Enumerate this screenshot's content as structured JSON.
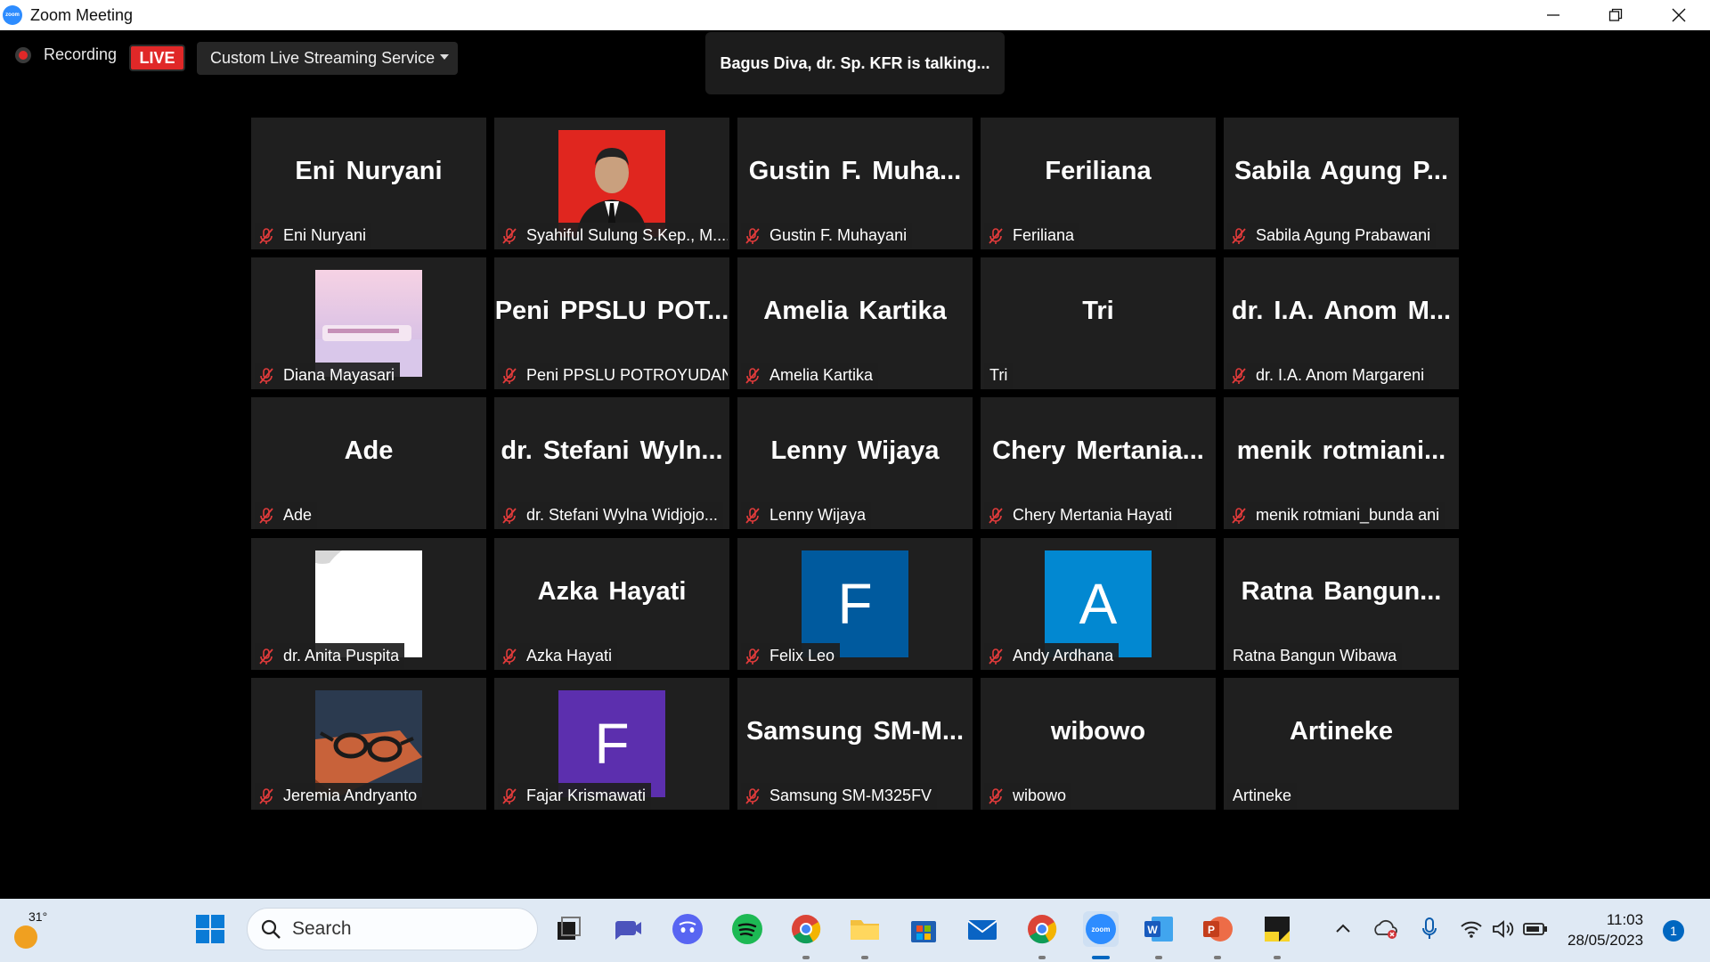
{
  "window": {
    "title": "Zoom Meeting",
    "app_icon_label": "zoom"
  },
  "toolbar": {
    "recording_label": "Recording",
    "live_label": "LIVE",
    "stream_service": "Custom Live Streaming Service"
  },
  "talking_banner": "Bagus Diva, dr. Sp. KFR is talking...",
  "participants": [
    {
      "display": "Eni Nuryani",
      "name": "Eni Nuryani",
      "muted": true
    },
    {
      "display": "",
      "name": "Syahiful Sulung S.Kep., M....",
      "muted": true,
      "photo": "portrait-red-background"
    },
    {
      "display": "Gustin F. Muha...",
      "name": "Gustin F. Muhayani",
      "muted": true
    },
    {
      "display": "Feriliana",
      "name": "Feriliana",
      "muted": true
    },
    {
      "display": "Sabila Agung P...",
      "name": "Sabila Agung Prabawani",
      "muted": true
    },
    {
      "display": "",
      "name": "Diana Mayasari",
      "muted": true,
      "photo": "pink-train-scene"
    },
    {
      "display": "Peni PPSLU POT...",
      "name": "Peni PPSLU POTROYUDAN",
      "muted": true
    },
    {
      "display": "Amelia Kartika",
      "name": "Amelia Kartika",
      "muted": true
    },
    {
      "display": "Tri",
      "name": "Tri",
      "muted": false
    },
    {
      "display": "dr. I.A. Anom M...",
      "name": "dr. I.A. Anom Margareni",
      "muted": true
    },
    {
      "display": "Ade",
      "name": "Ade",
      "muted": true
    },
    {
      "display": "dr. Stefani Wyln...",
      "name": "dr. Stefani Wylna Widjojo...",
      "muted": true
    },
    {
      "display": "Lenny Wijaya",
      "name": "Lenny Wijaya",
      "muted": true
    },
    {
      "display": "Chery Mertania...",
      "name": "Chery Mertania Hayati",
      "muted": true
    },
    {
      "display": "menik rotmiani...",
      "name": "menik rotmiani_bunda ani",
      "muted": true
    },
    {
      "display": "",
      "name": "dr. Anita Puspita",
      "muted": true,
      "photo": "white-blank"
    },
    {
      "display": "Azka Hayati",
      "name": "Azka Hayati",
      "muted": true
    },
    {
      "display": "",
      "name": "Felix Leo",
      "muted": true,
      "avatar_letter": "F",
      "avatar_color": "#005a9e"
    },
    {
      "display": "",
      "name": "Andy Ardhana",
      "muted": true,
      "avatar_letter": "A",
      "avatar_color": "#0288d1"
    },
    {
      "display": "Ratna Bangun...",
      "name": "Ratna Bangun Wibawa",
      "muted": false
    },
    {
      "display": "",
      "name": "Jeremia Andryanto",
      "muted": true,
      "photo": "glasses-on-book"
    },
    {
      "display": "",
      "name": "Fajar Krismawati",
      "muted": true,
      "avatar_letter": "F",
      "avatar_color": "#5c2fae"
    },
    {
      "display": "Samsung SM-M...",
      "name": "Samsung SM-M325FV",
      "muted": true
    },
    {
      "display": "wibowo",
      "name": "wibowo",
      "muted": true
    },
    {
      "display": "Artineke",
      "name": "Artineke",
      "muted": false
    }
  ],
  "taskbar": {
    "weather_temp": "31°",
    "search_placeholder": "Search",
    "time": "11:03",
    "date": "28/05/2023",
    "notification_count": "1",
    "pinned_apps": [
      "start",
      "search",
      "task-view",
      "zoom-chat",
      "discord",
      "spotify",
      "chrome",
      "file-explorer",
      "microsoft-store",
      "mail",
      "chrome-profile",
      "zoom",
      "word",
      "powerpoint",
      "sticky-notes"
    ]
  }
}
